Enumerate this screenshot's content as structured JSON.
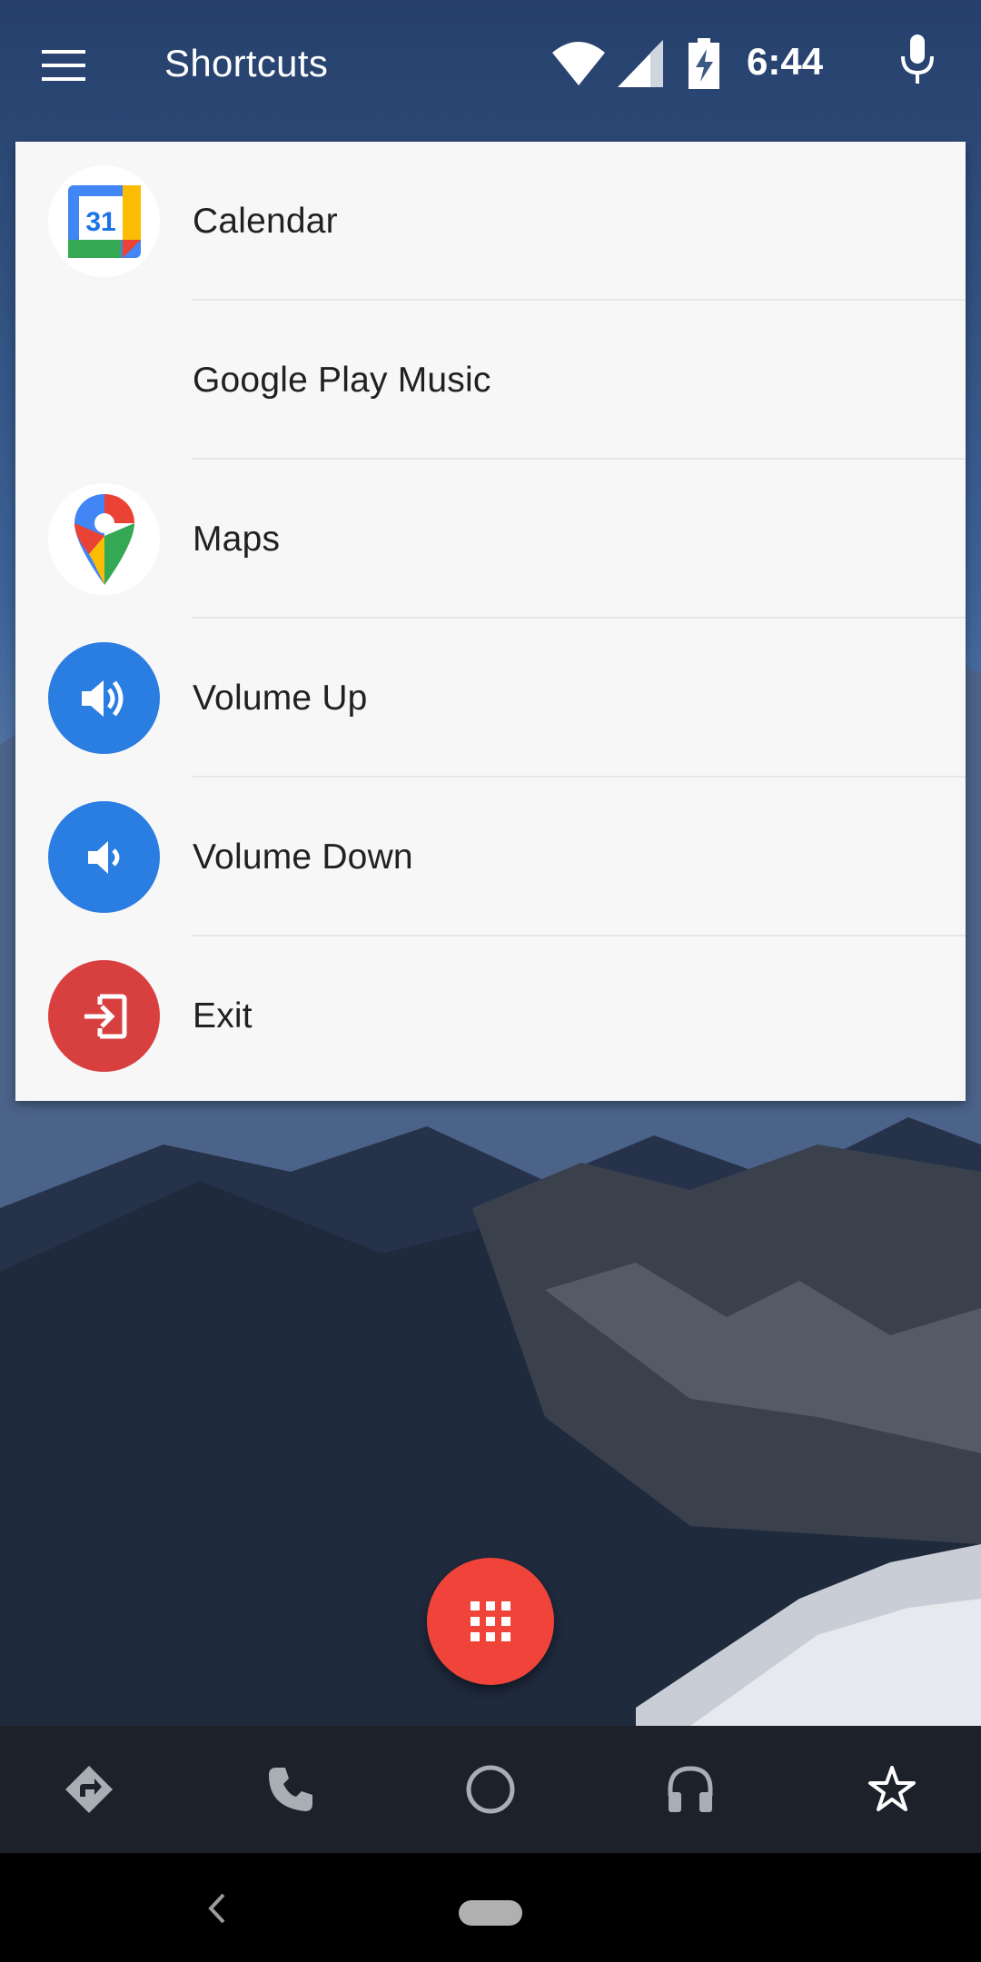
{
  "app_bar": {
    "title": "Shortcuts",
    "menu_icon": "hamburger-menu-icon",
    "mic_icon": "microphone-icon"
  },
  "status_bar": {
    "time": "6:44",
    "icons": [
      "wifi-icon",
      "cell-signal-icon",
      "battery-charging-icon"
    ]
  },
  "shortcuts": {
    "items": [
      {
        "label": "Calendar",
        "icon": "calendar-icon"
      },
      {
        "label": "Google Play Music",
        "icon": ""
      },
      {
        "label": "Maps",
        "icon": "maps-pin-icon"
      },
      {
        "label": "Volume Up",
        "icon": "volume-up-icon"
      },
      {
        "label": "Volume Down",
        "icon": "volume-down-icon"
      },
      {
        "label": "Exit",
        "icon": "exit-icon"
      }
    ]
  },
  "calendar_icon_text": "31",
  "fab": {
    "icon": "app-grid-icon",
    "color": "#f0443a"
  },
  "car_nav": {
    "items": [
      "navigation-icon",
      "phone-icon",
      "home-circle-icon",
      "headphones-icon",
      "star-icon"
    ]
  },
  "system_nav": {
    "items": [
      "back-icon",
      "home-pill-icon"
    ]
  },
  "colors": {
    "accent_blue": "#2a7de1",
    "exit_red": "#d84040",
    "fab_red": "#f0443a",
    "card_bg": "#f7f7f7"
  }
}
